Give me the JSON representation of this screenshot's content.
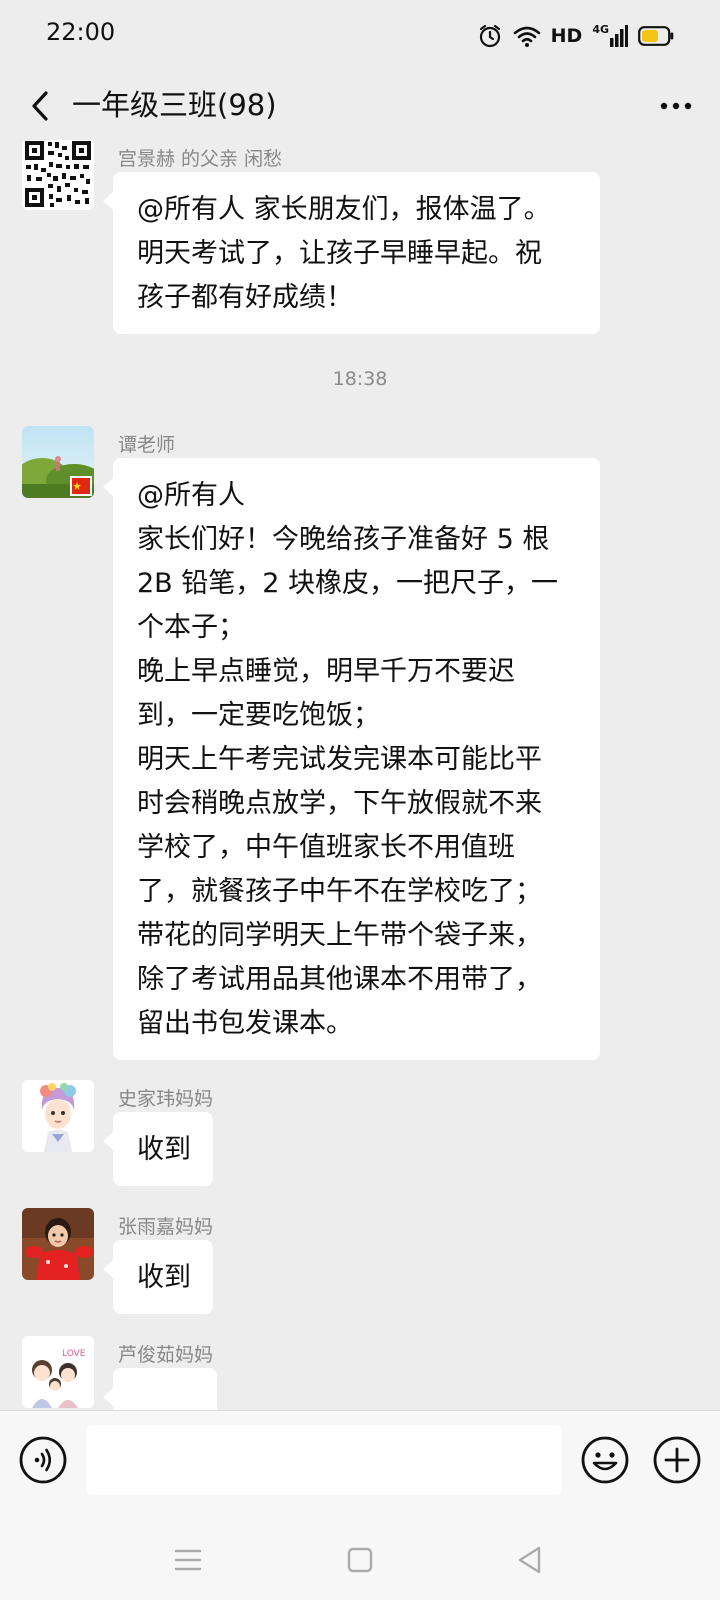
{
  "status_bar": {
    "time": "22:00",
    "hd_label": "HD",
    "network_label": "4G",
    "icons": [
      "alarm-icon",
      "wifi-icon",
      "signal-icon",
      "battery-icon"
    ],
    "battery_color": "#f5c518"
  },
  "header": {
    "title": "一年级三班(98)",
    "back_icon": "chevron-left-icon",
    "more_icon": "ellipsis-icon"
  },
  "messages": [
    {
      "sender": "宫景赫  的父亲 闲愁",
      "avatar": "qr-code-avatar",
      "lines": [
        "@所有人 家长朋友们，报体温了。",
        "明天考试了，让孩子早睡早起。祝",
        "孩子都有好成绩！"
      ]
    },
    {
      "sender": "谭老师",
      "avatar": "landscape-photo-avatar",
      "lines": [
        "@所有人",
        "家长们好！今晚给孩子准备好 5 根",
        "2B 铅笔，2 块橡皮，一把尺子，一",
        "个本子；",
        "晚上早点睡觉，明早千万不要迟",
        "到，一定要吃饱饭；",
        "明天上午考完试发完课本可能比平",
        "时会稍晚点放学，下午放假就不来",
        "学校了，中午值班家长不用值班",
        "了，就餐孩子中午不在学校吃了；",
        "带花的同学明天上午带个袋子来，",
        "除了考试用品其他课本不用带了，",
        "留出书包发课本。"
      ]
    },
    {
      "sender": "史家玮妈妈",
      "avatar": "cartoon-girl-avatar",
      "lines": [
        "收到"
      ]
    },
    {
      "sender": "张雨嘉妈妈",
      "avatar": "child-photo-avatar",
      "lines": [
        "收到"
      ]
    },
    {
      "sender": "芦俊茹妈妈",
      "avatar": "cartoon-family-avatar",
      "lines": []
    }
  ],
  "timestamp": "18:38",
  "input_bar": {
    "voice_icon": "voice-icon",
    "emoji_icon": "emoji-icon",
    "plus_icon": "plus-circle-icon",
    "input_value": ""
  },
  "nav_bar": {
    "icons": [
      "menu-icon",
      "home-square-icon",
      "back-triangle-icon"
    ]
  },
  "colors": {
    "background": "#ededed",
    "bubble": "#ffffff",
    "sender_text": "#888888"
  }
}
